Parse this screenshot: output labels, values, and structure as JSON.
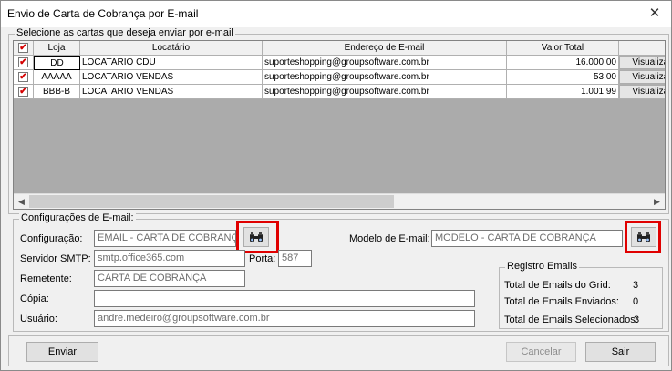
{
  "window": {
    "title": "Envio de Carta de Cobrança por E-mail",
    "close_glyph": "✕"
  },
  "grid_group": {
    "title": "Selecione as cartas que deseja enviar por e-mail"
  },
  "grid": {
    "columns": [
      "",
      "Loja",
      "Locatário",
      "Endereço de E-mail",
      "Valor Total",
      ""
    ],
    "rows": [
      {
        "checked": true,
        "loja": "DD",
        "locatario": "LOCATARIO CDU",
        "email": "suporteshopping@groupsoftware.com.br",
        "valor": "16.000,00",
        "action": "Visualizar"
      },
      {
        "checked": true,
        "loja": "AAAAA",
        "locatario": "LOCATARIO VENDAS",
        "email": "suporteshopping@groupsoftware.com.br",
        "valor": "53,00",
        "action": "Visualizar"
      },
      {
        "checked": true,
        "loja": "BBB-B",
        "locatario": "LOCATARIO VENDAS",
        "email": "suporteshopping@groupsoftware.com.br",
        "valor": "1.001,99",
        "action": "Visualizar"
      }
    ],
    "check_glyph": "✔",
    "scroll_left": "◀",
    "scroll_right": "▶"
  },
  "config": {
    "title": "Configurações de E-mail:",
    "configuracao_label": "Configuração:",
    "configuracao_value": "EMAIL - CARTA DE COBRANÇA",
    "modelo_label": "Modelo de E-mail:",
    "modelo_value": "MODELO - CARTA DE COBRANÇA",
    "smtp_label": "Servidor SMTP:",
    "smtp_value": "smtp.office365.com",
    "porta_label": "Porta:",
    "porta_value": "587",
    "remetente_label": "Remetente:",
    "remetente_value": "CARTA DE COBRANÇA",
    "copia_label": "Cópia:",
    "copia_value": "",
    "usuario_label": "Usuário:",
    "usuario_value": "andre.medeiro@groupsoftware.com.br"
  },
  "registro": {
    "title": "Registro Emails",
    "grid_label": "Total de Emails do Grid:",
    "grid_value": "3",
    "enviados_label": "Total de Emails Enviados:",
    "enviados_value": "0",
    "selecionados_label": "Total de Emails Selecionados:",
    "selecionados_value": "3"
  },
  "buttons": {
    "enviar": "Enviar",
    "cancelar": "Cancelar",
    "sair": "Sair"
  },
  "colors": {
    "highlight": "#e00000",
    "check": "#d40000"
  }
}
